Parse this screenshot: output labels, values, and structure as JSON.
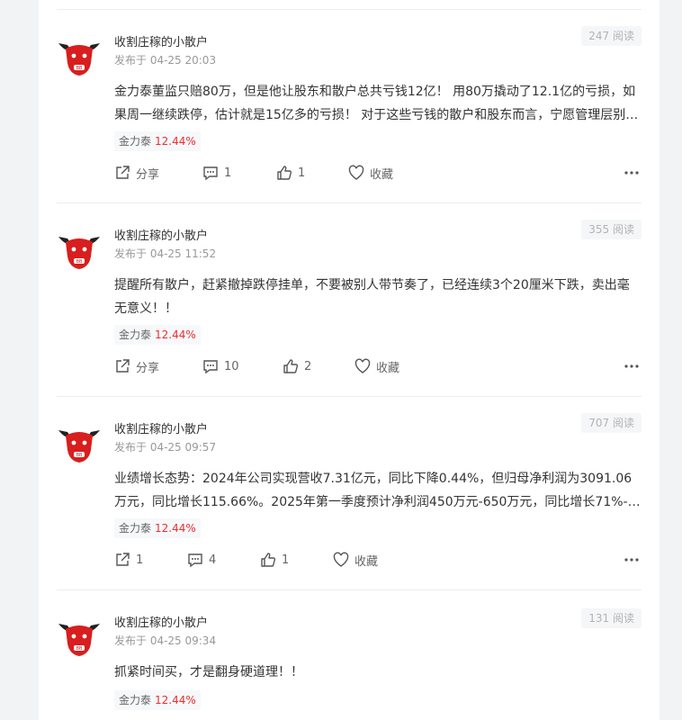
{
  "posts": [
    {
      "author": "收割庄稼的小散户",
      "time": "发布于 04-25 20:03",
      "views": "247 阅读",
      "content": "金力泰董监只赔80万，但是他让股东和散户总共亏钱12亿！ 用80万撬动了12.1亿的亏损，如果周一继续跌停，估计就是15亿多的亏损！ 对于这些亏钱的散户和股东而言，宁愿管理层别…",
      "stock_name": "金力泰",
      "stock_change": "12.44%",
      "share": "分享",
      "comments": "1",
      "likes": "1",
      "collect": "收藏"
    },
    {
      "author": "收割庄稼的小散户",
      "time": "发布于 04-25 11:52",
      "views": "355 阅读",
      "content": "提醒所有散户，赶紧撤掉跌停挂单，不要被别人带节奏了，已经连续3个20厘米下跌，卖出毫无意义！！",
      "stock_name": "金力泰",
      "stock_change": "12.44%",
      "share": "分享",
      "comments": "10",
      "likes": "2",
      "collect": "收藏"
    },
    {
      "author": "收割庄稼的小散户",
      "time": "发布于 04-25 09:57",
      "views": "707 阅读",
      "content": "业绩增长态势：2024年公司实现营收7.31亿元，同比下降0.44%，但归母净利润为3091.06万元，同比增长115.66%。2025年第一季度预计净利润450万元-650万元，同比增长71%-…",
      "stock_name": "金力泰",
      "stock_change": "12.44%",
      "share": "1",
      "comments": "4",
      "likes": "1",
      "collect": "收藏"
    },
    {
      "author": "收割庄稼的小散户",
      "time": "发布于 04-25 09:34",
      "views": "131 阅读",
      "content": "抓紧时间买，才是翻身硬道理！！",
      "stock_name": "金力泰",
      "stock_change": "12.44%"
    }
  ],
  "icons": {
    "avatar": "red-bull-avatar",
    "share": "share-icon",
    "comment": "comment-icon",
    "like": "thumbs-up-icon",
    "collect": "heart-icon",
    "more": "more-dots-icon"
  },
  "colors": {
    "rise": "#e93030",
    "bull": "#d81e1e"
  }
}
